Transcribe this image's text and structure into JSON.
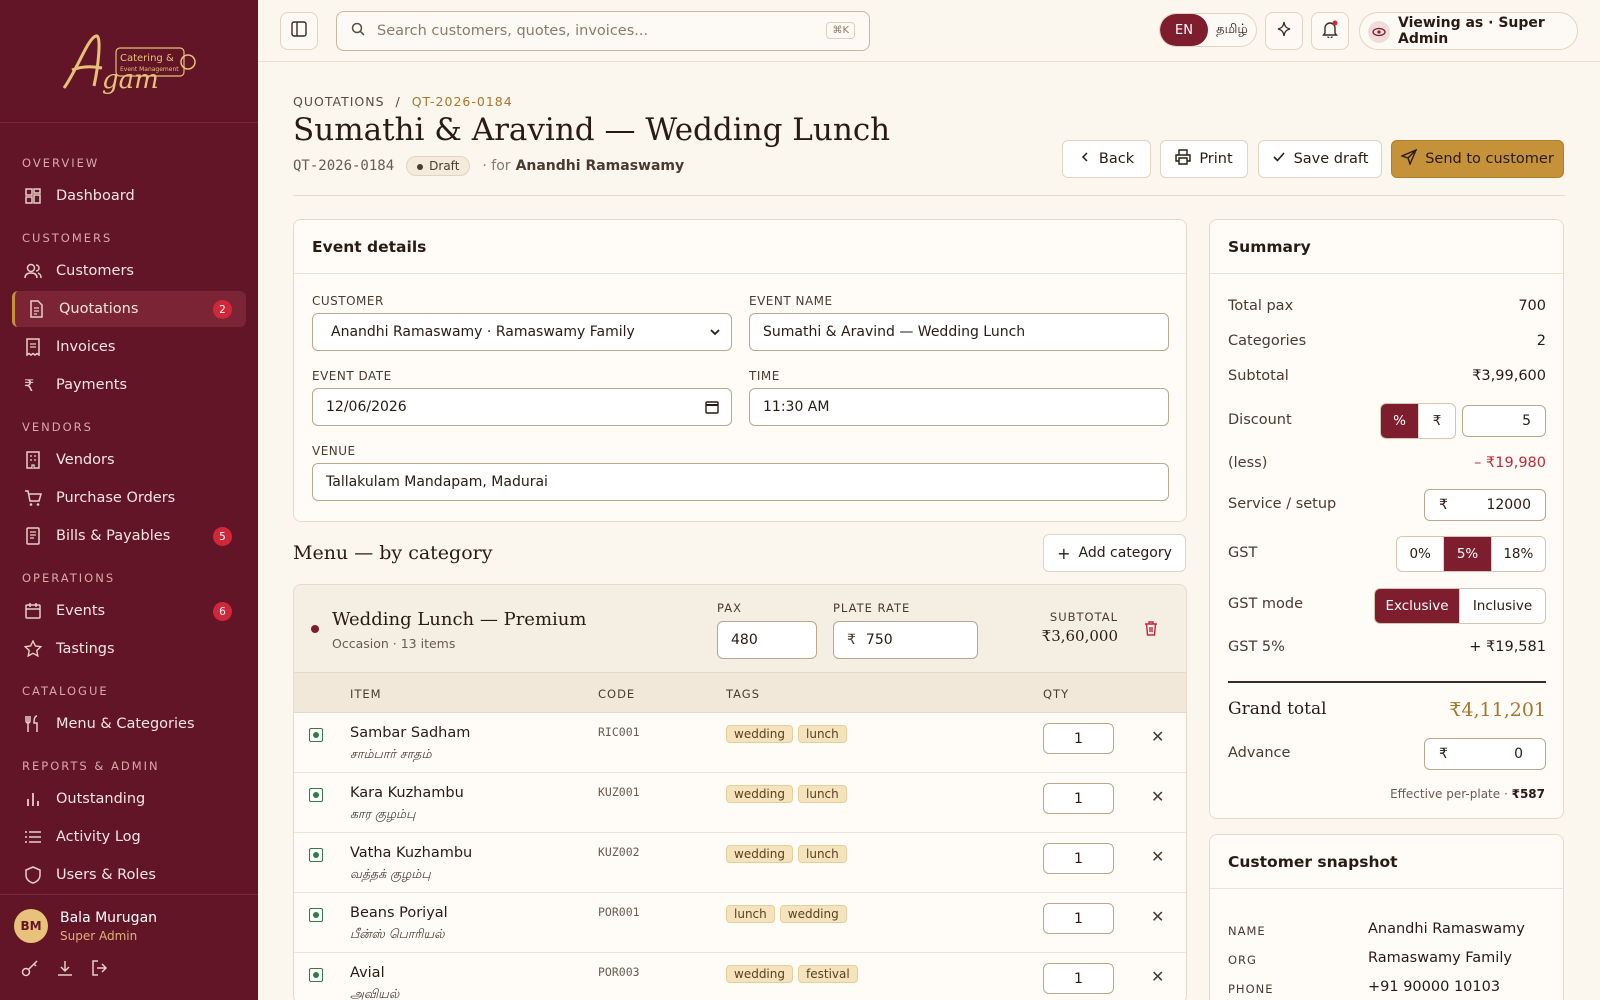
{
  "sidebar": {
    "sections": {
      "overview": "OVERVIEW",
      "customers": "CUSTOMERS",
      "vendors": "VENDORS",
      "operations": "OPERATIONS",
      "catalogue": "CATALOGUE",
      "reports": "REPORTS & ADMIN"
    },
    "items": {
      "dashboard": "Dashboard",
      "customers": "Customers",
      "quotations": "Quotations",
      "quotations_badge": "2",
      "invoices": "Invoices",
      "payments": "Payments",
      "vendors": "Vendors",
      "purchase_orders": "Purchase Orders",
      "bills": "Bills & Payables",
      "bills_badge": "5",
      "events": "Events",
      "events_badge": "6",
      "tastings": "Tastings",
      "menu": "Menu & Categories",
      "outstanding": "Outstanding",
      "activity": "Activity Log",
      "users": "Users & Roles"
    },
    "user": {
      "initials": "BM",
      "name": "Bala Murugan",
      "role": "Super Admin"
    },
    "logo_text": {
      "a": "A",
      "gam": "gam",
      "catering": "Catering &",
      "sub": "Event Management"
    }
  },
  "topbar": {
    "search_placeholder": "Search customers, quotes, invoices...",
    "shortcut": "⌘K",
    "lang_en": "EN",
    "lang_ta": "தமிழ்",
    "viewing": "Viewing as · Super Admin"
  },
  "header": {
    "crumb_root": "QUOTATIONS",
    "crumb_sep": "/",
    "crumb_id": "QT-2026-0184",
    "title": "Sumathi & Aravind — Wedding Lunch",
    "quote_id": "QT-2026-0184",
    "status": "Draft",
    "for_prefix": "· for",
    "for_name": "Anandhi Ramaswamy",
    "back": "Back",
    "print": "Print",
    "save": "Save draft",
    "send": "Send to customer"
  },
  "event": {
    "heading": "Event details",
    "customer_label": "CUSTOMER",
    "customer_value": "Anandhi Ramaswamy · Ramaswamy Family",
    "name_label": "EVENT NAME",
    "name_value": "Sumathi & Aravind — Wedding Lunch",
    "date_label": "EVENT DATE",
    "date_value": "12/06/2026",
    "time_label": "TIME",
    "time_value": "11:30 AM",
    "venue_label": "VENUE",
    "venue_value": "Tallakulam Mandapam, Madurai"
  },
  "menu": {
    "title": "Menu — by category",
    "add_category": "Add category",
    "category": {
      "name": "Wedding Lunch — Premium",
      "meta": "Occasion · 13 items",
      "pax_label": "PAX",
      "pax": "480",
      "rate_label": "PLATE RATE",
      "rate_symbol": "₹",
      "rate": "750",
      "subtotal_label": "SUBTOTAL",
      "subtotal": "₹3,60,000"
    },
    "columns": {
      "item": "ITEM",
      "code": "CODE",
      "tags": "TAGS",
      "qty": "QTY"
    },
    "rows": [
      {
        "name": "Sambar Sadham",
        "tamil": "சாம்பார் சாதம்",
        "code": "RIC001",
        "tags": [
          "wedding",
          "lunch"
        ],
        "qty": "1"
      },
      {
        "name": "Kara Kuzhambu",
        "tamil": "கார குழம்பு",
        "code": "KUZ001",
        "tags": [
          "wedding",
          "lunch"
        ],
        "qty": "1"
      },
      {
        "name": "Vatha Kuzhambu",
        "tamil": "வத்தக் குழம்பு",
        "code": "KUZ002",
        "tags": [
          "wedding",
          "lunch"
        ],
        "qty": "1"
      },
      {
        "name": "Beans Poriyal",
        "tamil": "பீன்ஸ் பொரியல்",
        "code": "POR001",
        "tags": [
          "lunch",
          "wedding"
        ],
        "qty": "1"
      },
      {
        "name": "Avial",
        "tamil": "அவியல்",
        "code": "POR003",
        "tags": [
          "wedding",
          "festival"
        ],
        "qty": "1"
      }
    ]
  },
  "summary": {
    "heading": "Summary",
    "total_pax_label": "Total pax",
    "total_pax": "700",
    "categories_label": "Categories",
    "categories": "2",
    "subtotal_label": "Subtotal",
    "subtotal": "₹3,99,600",
    "discount_label": "Discount",
    "disc_pct": "%",
    "disc_rs": "₹",
    "discount": "5",
    "less_label": "(less)",
    "less": "– ₹19,980",
    "service_label": "Service / setup",
    "service_symbol": "₹",
    "service": "12000",
    "gst_label": "GST",
    "gst0": "0%",
    "gst5": "5%",
    "gst18": "18%",
    "gst_mode_label": "GST mode",
    "exclusive": "Exclusive",
    "inclusive": "Inclusive",
    "gst_amt_label": "GST 5%",
    "gst_amt": "+ ₹19,581",
    "grand_label": "Grand total",
    "grand": "₹4,11,201",
    "advance_label": "Advance",
    "advance_symbol": "₹",
    "advance": "0",
    "perplate_label": "Effective per-plate ·",
    "perplate": "₹587"
  },
  "snapshot": {
    "heading": "Customer snapshot",
    "name_label": "NAME",
    "name": "Anandhi Ramaswamy",
    "org_label": "ORG",
    "org": "Ramaswamy Family",
    "phone_label": "PHONE",
    "phone": "+91 90000 10103"
  },
  "colors": {
    "sidebar": "#611527",
    "accent": "#c59239",
    "primary": "#7d1d2e",
    "badge": "#d0283a"
  }
}
